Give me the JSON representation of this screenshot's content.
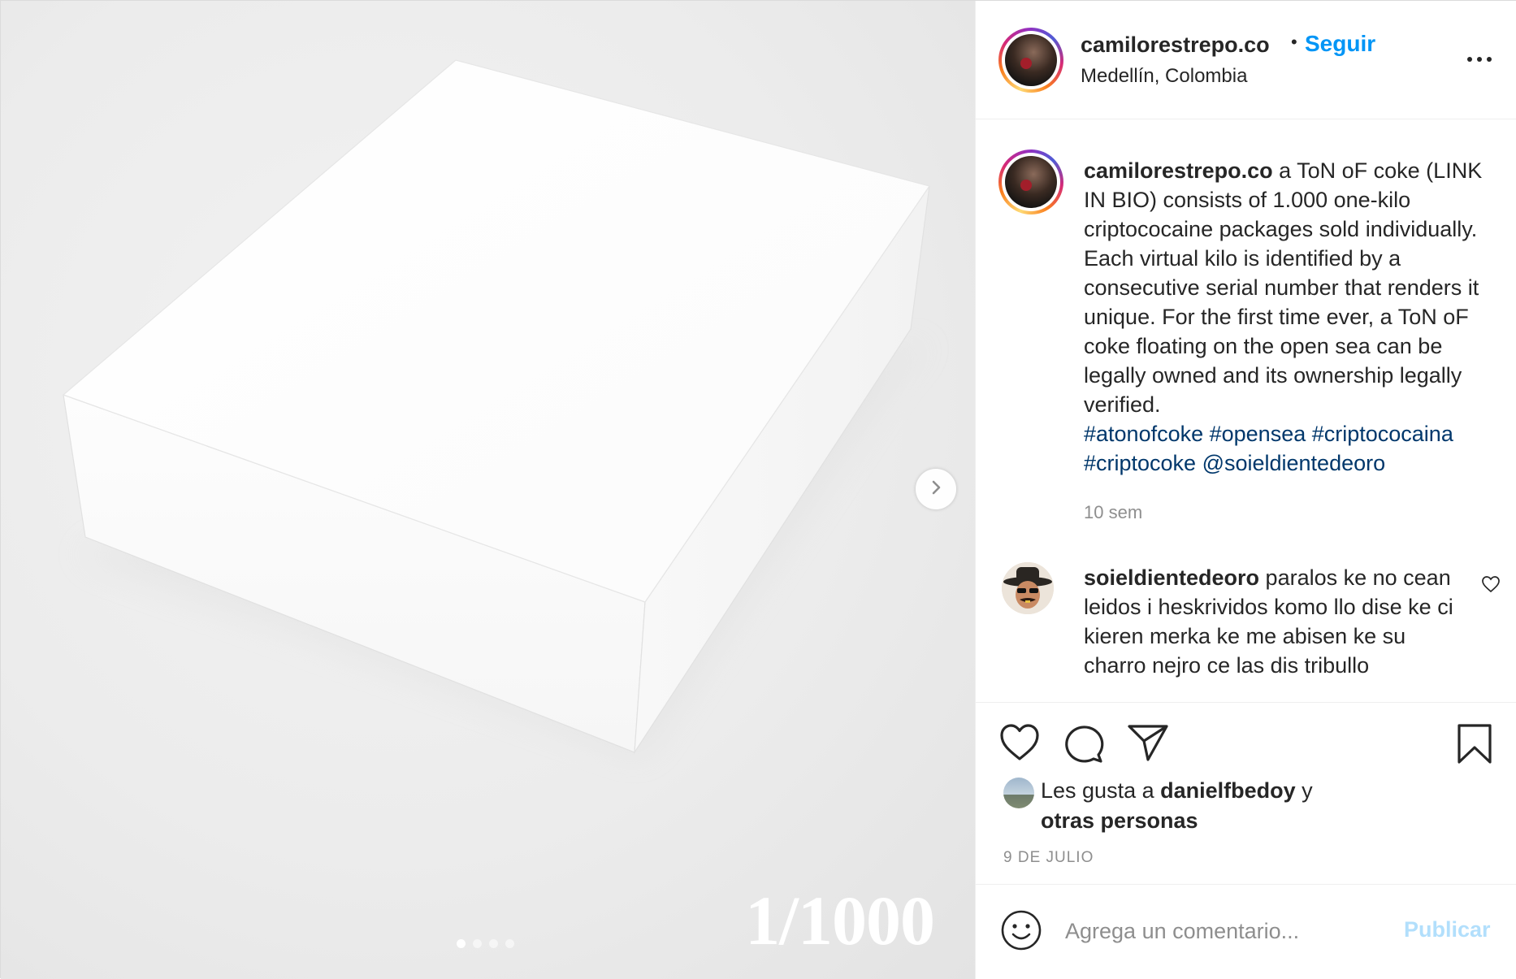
{
  "colors": {
    "accent": "#0095f6",
    "hashtag": "#00376b",
    "muted": "#8e8e8e",
    "publish_disabled": "#b2dffc"
  },
  "header": {
    "username": "camilorestrepo.co",
    "separator": "•",
    "follow_label": "Seguir",
    "location": "Medellín, Colombia",
    "more_icon": "more-horizontal-icon"
  },
  "media": {
    "edition_label": "1/1000",
    "slides_total": 4,
    "active_slide": 1,
    "next_icon": "chevron-right-icon"
  },
  "caption": {
    "username": "camilorestrepo.co",
    "text": " a ToN oF coke (LINK IN BIO) consists of 1.000 one-kilo criptococaine packages sold individually. Each virtual kilo is identified by a consecutive serial number that renders it unique. For the first time ever, a ToN oF coke floating on the open sea can be legally owned and its ownership legally verified.",
    "tags": "#atonofcoke #opensea #criptococaina #criptocoke @soieldientedeoro",
    "time_ago": "10 sem"
  },
  "comment": {
    "username": "soieldientedeoro",
    "text": " paralos ke no cean leidos i heskrividos komo llo dise ke ci kieren merka ke me abisen ke su charro nejro ce las dis tribullo"
  },
  "actions": {
    "icons": [
      "heart-icon",
      "comment-icon",
      "share-icon",
      "bookmark-icon"
    ],
    "likes_prefix": "Les gusta a ",
    "liked_by": "danielfbedoy",
    "likes_mid": " y",
    "likes_others": "otras personas",
    "date": "9 DE JULIO"
  },
  "composer": {
    "placeholder": "Agrega un comentario...",
    "publish_label": "Publicar"
  }
}
